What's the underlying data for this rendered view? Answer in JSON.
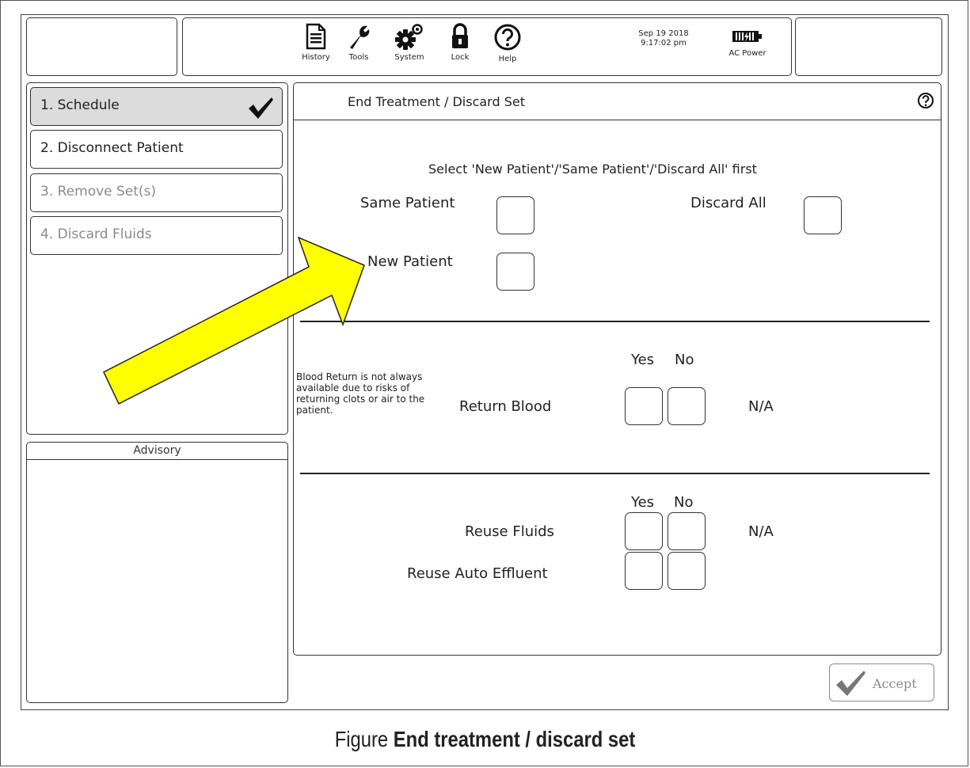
{
  "toolbar": {
    "items": [
      {
        "label": "History",
        "icon": "document-icon"
      },
      {
        "label": "Tools",
        "icon": "wrench-icon"
      },
      {
        "label": "System",
        "icon": "gears-icon"
      },
      {
        "label": "Lock",
        "icon": "lock-icon"
      },
      {
        "label": "Help",
        "icon": "help-icon"
      }
    ],
    "date": "Sep 19 2018",
    "time": "9:17:02 pm",
    "power_label": "AC Power",
    "battery_icon": "battery-plug-icon"
  },
  "sidebar": {
    "steps": [
      {
        "label": "1. Schedule",
        "state": "completed"
      },
      {
        "label": "2. Disconnect Patient",
        "state": "active"
      },
      {
        "label": "3. Remove Set(s)",
        "state": "disabled"
      },
      {
        "label": "4. Discard Fluids",
        "state": "disabled"
      }
    ],
    "advisory_title": "Advisory"
  },
  "main": {
    "title": "End Treatment / Discard Set",
    "instruction": "Select 'New Patient'/'Same Patient'/'Discard All' first",
    "same_patient": "Same Patient",
    "discard_all": "Discard All",
    "new_patient": "New Patient",
    "blood_note": "Blood Return is not always available due to risks of returning clots or air to the patient.",
    "return_blood": "Return Blood",
    "yes": "Yes",
    "no": "No",
    "na": "N/A",
    "reuse_fluids": "Reuse Fluids",
    "reuse_auto_effluent": "Reuse Auto Effluent",
    "accept": "Accept"
  },
  "caption": {
    "prefix": "Figure",
    "title": "End treatment / discard set"
  },
  "colors": {
    "arrow_fill": "#ffff00",
    "completed_step_bg": "#dcdcdc",
    "disabled_text": "#8a8a8a"
  }
}
